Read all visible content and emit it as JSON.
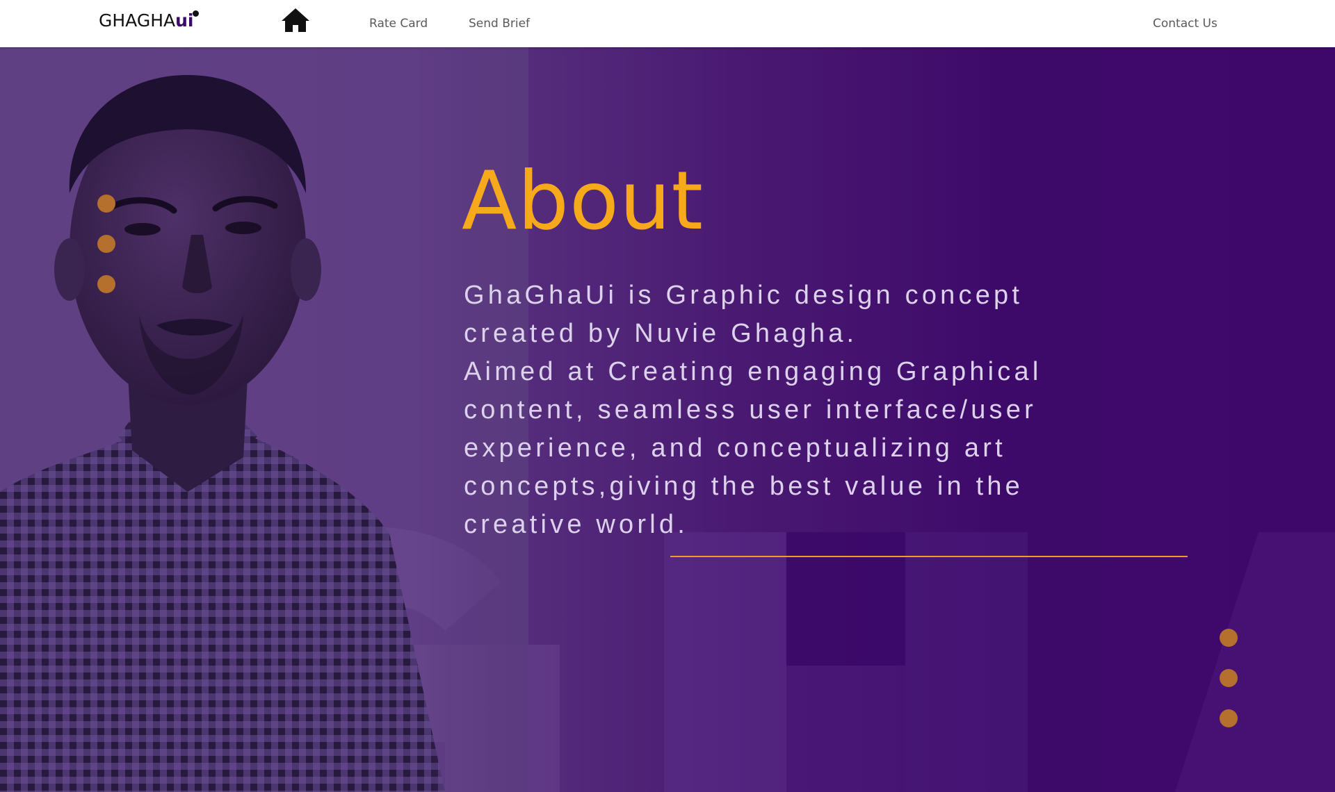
{
  "nav": {
    "logo_main": "GHAGHA",
    "logo_accent": "ui",
    "home_icon": "home-icon",
    "links": [
      "Rate Card",
      "Send Brief"
    ],
    "contact": "Contact Us"
  },
  "about": {
    "title": "About",
    "paragraph_1": "GhaGhaUi is Graphic design concept created by Nuvie Ghagha.",
    "paragraph_2": "Aimed at Creating engaging Graphical content, seamless user interface/user experience, and conceptualizing art concepts,giving the best value in the creative world."
  },
  "colors": {
    "accent": "#f7a91c",
    "dot": "#b5702d",
    "hero_dark": "#3e086a",
    "text": "#dcd2ec"
  }
}
